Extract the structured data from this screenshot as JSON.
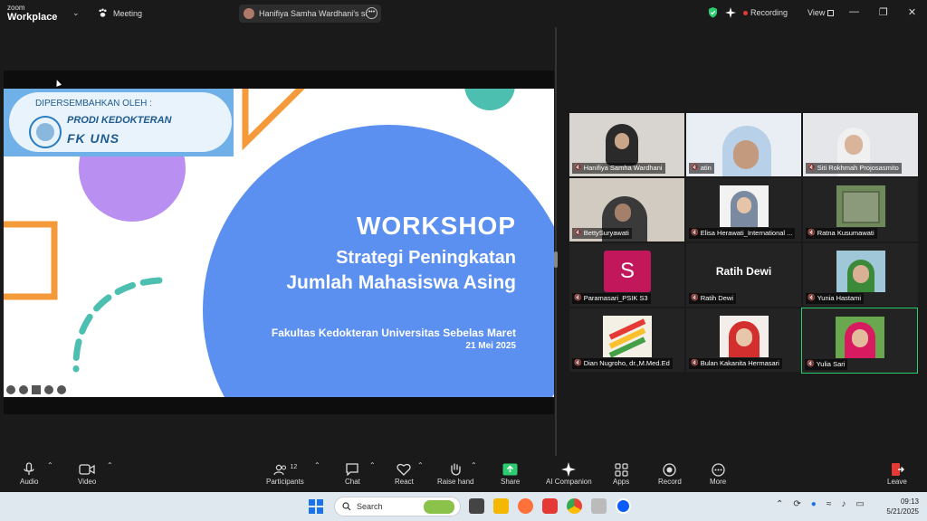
{
  "topbar": {
    "logo_top": "zoom",
    "logo_bottom": "Workplace",
    "meeting_label": "Meeting",
    "share_label": "Hanifiya Samha Wardhani's screen",
    "recording_label": "Recording",
    "view_label": "View"
  },
  "slide": {
    "banner_line1": "DIPERSEMBAHKAN OLEH :",
    "banner_line2": "PRODI KEDOKTERAN",
    "banner_line3": "FK UNS",
    "title": "WORKSHOP",
    "subtitle1": "Strategi Peningkatan",
    "subtitle2": "Jumlah Mahasiswa Asing",
    "institution": "Fakultas Kedokteran Universitas Sebelas Maret",
    "date": "21 Mei 2025"
  },
  "gallery": {
    "tiles": [
      {
        "name": "Hanifiya Samha Wardhani"
      },
      {
        "name": "atin"
      },
      {
        "name": "Siti Rokhmah Projosasmito"
      },
      {
        "name": "BettySuryawati"
      },
      {
        "name": "Elisa Herawati_International ..."
      },
      {
        "name": "Ratna Kusumawati"
      },
      {
        "name": "Paramasari_PSIK S3",
        "initial": "S"
      },
      {
        "name": "Ratih Dewi",
        "center_text": "Ratih Dewi"
      },
      {
        "name": "Yunia Hastami"
      },
      {
        "name": "Dian Nugroho, dr.,M.Med.Ed"
      },
      {
        "name": "Bulan Kakanita Hermasari"
      },
      {
        "name": "Yulia Sari"
      }
    ]
  },
  "toolbar": {
    "audio": "Audio",
    "video": "Video",
    "participants": "Participants",
    "participants_count": "12",
    "chat": "Chat",
    "react": "React",
    "raise_hand": "Raise hand",
    "share": "Share",
    "ai_companion": "AI Companion",
    "apps": "Apps",
    "record": "Record",
    "more": "More",
    "leave": "Leave"
  },
  "taskbar": {
    "search_placeholder": "Search",
    "time": "09:13",
    "date": "5/21/2025"
  },
  "colors": {
    "slide_blue": "#5b8ff0",
    "slide_purple": "#b98ff2",
    "slide_orange": "#f59a3a",
    "slide_teal": "#4cbfb0",
    "active_speaker": "#2ecc71",
    "share_green": "#2ecc71",
    "leave_red": "#e53935"
  }
}
